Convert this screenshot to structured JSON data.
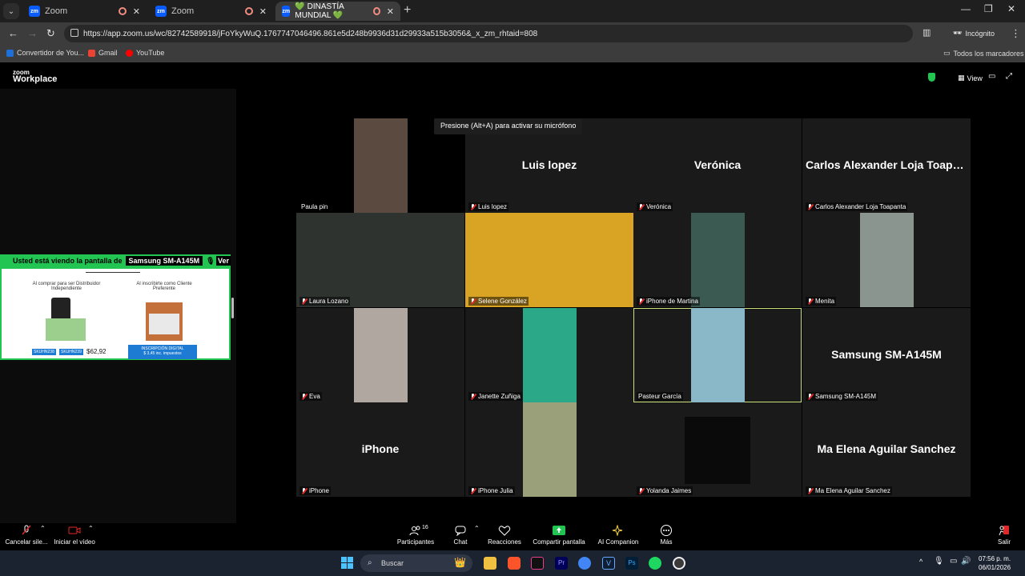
{
  "browser": {
    "tabs": [
      {
        "title": "Zoom"
      },
      {
        "title": "Zoom"
      },
      {
        "title": "💚 DINASTÍA MUNDIAL 💚"
      }
    ],
    "url": "https://app.zoom.us/wc/82742589918/jFoYkyWuQ.1767747046496.861e5d248b9936d31d29933a515b3056&_x_zm_rhtaid=808",
    "profile": "Incógnito",
    "bookmarks": [
      "Convertidor de You...",
      "Gmail",
      "YouTube"
    ],
    "all_bookmarks": "Todos los marcadores"
  },
  "zoom": {
    "logo_top": "zoom",
    "logo_bottom": "Workplace",
    "view_label": "View",
    "mic_toast": "Presione (Alt+A) para activar su micrófono",
    "share_banner": "Usted está viendo la pantalla de",
    "share_device": "Samsung SM-A145M",
    "share_view_suffix": "Ver",
    "share_content": {
      "left_title": "Al comprar para ser Distribuidor Independiente",
      "right_title": "Al inscribirte como Cliente Preferente",
      "price": "$62,92",
      "badge": "INSCRIPCIÓN DIGITAL",
      "badge_sub": "$ 3,45 inc. impuestos",
      "tag1": "SKUHN238",
      "tag2": "SKUHN239"
    },
    "participants": [
      {
        "label": "Paula pin",
        "big": "",
        "muted": false,
        "video": true
      },
      {
        "label": "Luis lopez",
        "big": "Luis lopez",
        "muted": true,
        "video": false
      },
      {
        "label": "Verónica",
        "big": "Verónica",
        "muted": true,
        "video": false
      },
      {
        "label": "Carlos Alexander Loja Toapanta",
        "big": "Carlos Alexander Loja Toapa...",
        "muted": true,
        "video": false
      },
      {
        "label": "Laura Lozano",
        "big": "",
        "muted": true,
        "video": true
      },
      {
        "label": "Selene González",
        "big": "",
        "muted": true,
        "video": true
      },
      {
        "label": "iPhone de Martina",
        "big": "",
        "muted": true,
        "video": true
      },
      {
        "label": "Menita",
        "big": "",
        "muted": true,
        "video": true
      },
      {
        "label": "Eva",
        "big": "",
        "muted": true,
        "video": true
      },
      {
        "label": "Janette Zuñiga",
        "big": "",
        "muted": true,
        "video": true
      },
      {
        "label": "Pasteur García",
        "big": "",
        "muted": false,
        "video": true
      },
      {
        "label": "Samsung SM-A145M",
        "big": "Samsung SM-A145M",
        "muted": true,
        "video": false
      },
      {
        "label": "iPhone",
        "big": "iPhone",
        "muted": true,
        "video": false
      },
      {
        "label": "iPhone Julia",
        "big": "",
        "muted": true,
        "video": true
      },
      {
        "label": "Yolanda Jaimes",
        "big": "",
        "muted": true,
        "video": true
      },
      {
        "label": "Ma Elena Aguilar Sanchez",
        "big": "Ma Elena Aguilar Sanchez",
        "muted": true,
        "video": false
      }
    ],
    "toolbar": {
      "mute": "Cancelar sile...",
      "video": "Iniciar el vídeo",
      "participants": "Participantes",
      "participant_count": "16",
      "chat": "Chat",
      "reactions": "Reacciones",
      "share": "Compartir pantalla",
      "ai": "AI Companion",
      "more": "Más",
      "leave": "Salir"
    }
  },
  "taskbar": {
    "search": "Buscar",
    "time": "07:56 p. m.",
    "date": "06/01/2026"
  },
  "colors": {
    "zoom_green": "#23c552",
    "zoom_blue": "#0b5cff",
    "tile_bg": "#1a1a1a",
    "speaker_outline": "#cbe27a"
  }
}
